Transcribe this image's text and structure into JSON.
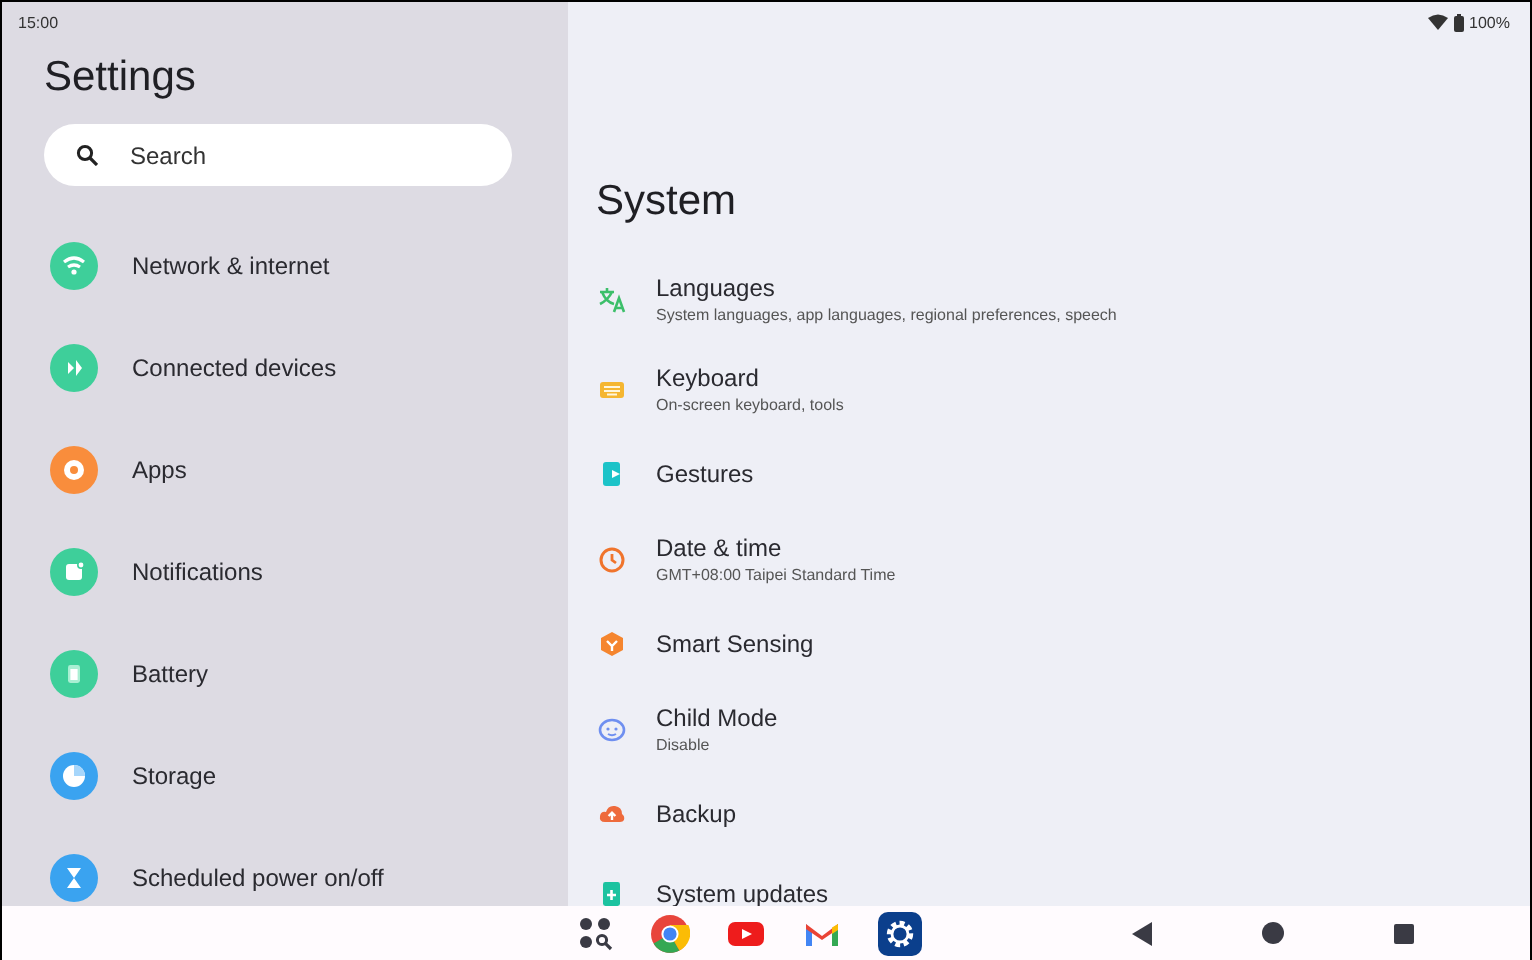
{
  "status_bar": {
    "time": "15:00",
    "battery": "100%"
  },
  "sidebar": {
    "title": "Settings",
    "search": {
      "placeholder": "Search"
    },
    "items": [
      {
        "label": "Network & internet"
      },
      {
        "label": "Connected devices"
      },
      {
        "label": "Apps"
      },
      {
        "label": "Notifications"
      },
      {
        "label": "Battery"
      },
      {
        "label": "Storage"
      },
      {
        "label": "Scheduled power on/off"
      }
    ]
  },
  "content": {
    "title": "System",
    "items": [
      {
        "label": "Languages",
        "summary": "System languages, app languages, regional preferences, speech"
      },
      {
        "label": "Keyboard",
        "summary": "On-screen keyboard, tools"
      },
      {
        "label": "Gestures"
      },
      {
        "label": "Date & time",
        "summary": "GMT+08:00 Taipei Standard Time"
      },
      {
        "label": "Smart Sensing"
      },
      {
        "label": "Child Mode",
        "summary": "Disable"
      },
      {
        "label": "Backup"
      },
      {
        "label": "System updates"
      }
    ]
  }
}
